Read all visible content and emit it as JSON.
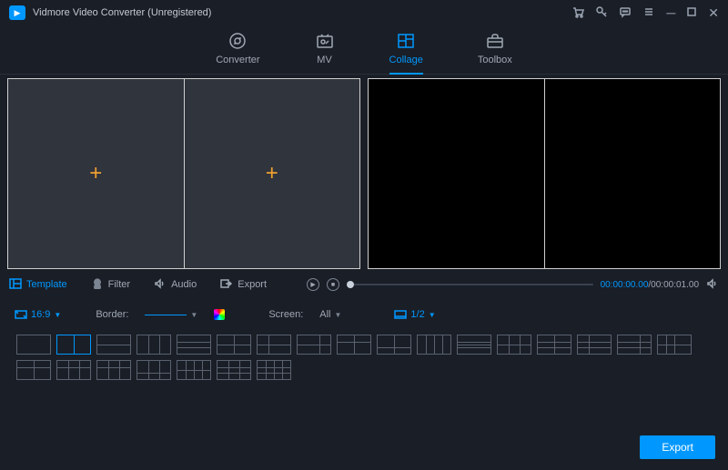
{
  "titlebar": {
    "title": "Vidmore Video Converter (Unregistered)"
  },
  "nav": {
    "converter": "Converter",
    "mv": "MV",
    "collage": "Collage",
    "toolbox": "Toolbox"
  },
  "tabs": {
    "template": "Template",
    "filter": "Filter",
    "audio": "Audio",
    "export": "Export"
  },
  "preview": {
    "current": "00:00:00.00",
    "total": "00:00:01.00"
  },
  "options": {
    "ratio": "16:9",
    "border_label": "Border:",
    "screen_label": "Screen:",
    "screen_value": "All",
    "page_value": "1/2"
  },
  "footer": {
    "export": "Export"
  }
}
